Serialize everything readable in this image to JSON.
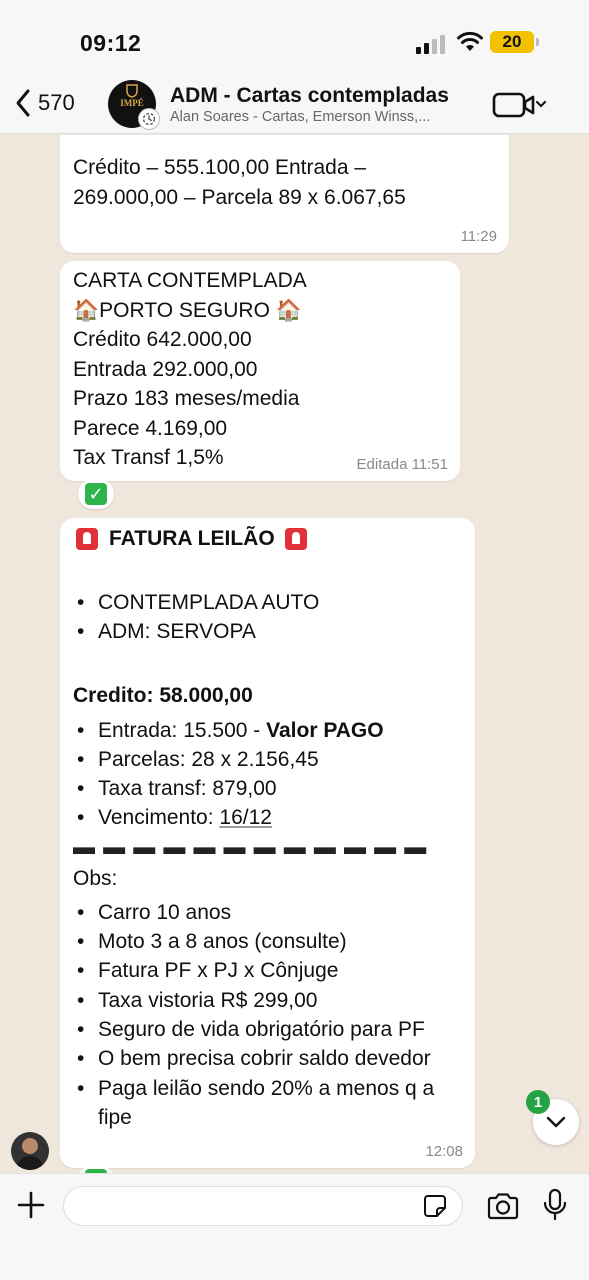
{
  "status_bar": {
    "time": "09:12",
    "battery": "20"
  },
  "header": {
    "back_count": "570",
    "avatar_text": "IMPÉ",
    "title": "ADM - Cartas contempladas",
    "subtitle": "Alan Soares - Cartas, Emerson Winss,..."
  },
  "messages": [
    {
      "lines": [
        "Crédito – 555.100,00  Entrada –",
        "269.000,00  – Parcela 89 x 6.067,65"
      ],
      "time": "11:29"
    },
    {
      "lines": [
        "CARTA CONTEMPLADA",
        "🏠PORTO SEGURO 🏠",
        "Crédito 642.000,00",
        "Entrada 292.000,00",
        "Prazo 183 meses/media",
        "Parece 4.169,00",
        "Tax Transf 1,5%"
      ],
      "time": "Editada 11:51"
    },
    {
      "heading": "FATURA LEILÃO",
      "list1": [
        "CONTEMPLADA AUTO",
        "ADM: SERVOPA"
      ],
      "credit": "Credito: 58.000,00",
      "list2": {
        "entrada_prefix": "Entrada: 15.500 - ",
        "entrada_bold": "Valor PAGO",
        "parcelas": "Parcelas: 28 x 2.156,45",
        "taxa": "Taxa transf: 879,00",
        "venc_prefix": "Vencimento: ",
        "venc_date": "16/12"
      },
      "dashes": "▬ ▬ ▬ ▬ ▬ ▬ ▬ ▬ ▬ ▬ ▬ ▬",
      "obs_label": "Obs:",
      "obs": [
        "Carro 10 anos",
        "Moto 3 a 8 anos (consulte)",
        "Fatura PF x PJ x Cônjuge",
        "Taxa vistoria R$ 299,00",
        "Seguro de vida obrigatório para PF",
        "O bem precisa cobrir saldo devedor",
        "Paga leilão sendo 20% a menos q a",
        "fipe"
      ],
      "time": "12:08"
    }
  ],
  "reaction": "✓",
  "unread_count": "1",
  "icons": {
    "back": "chevron-left-icon",
    "video": "video-camera-icon",
    "plus": "plus-icon",
    "sticker": "sticker-icon",
    "camera": "camera-icon",
    "mic": "microphone-icon",
    "scroll": "chevron-down-icon"
  },
  "colors": {
    "accent_green": "#25a244",
    "battery": "#f2c200",
    "siren_red": "#e0303a"
  }
}
